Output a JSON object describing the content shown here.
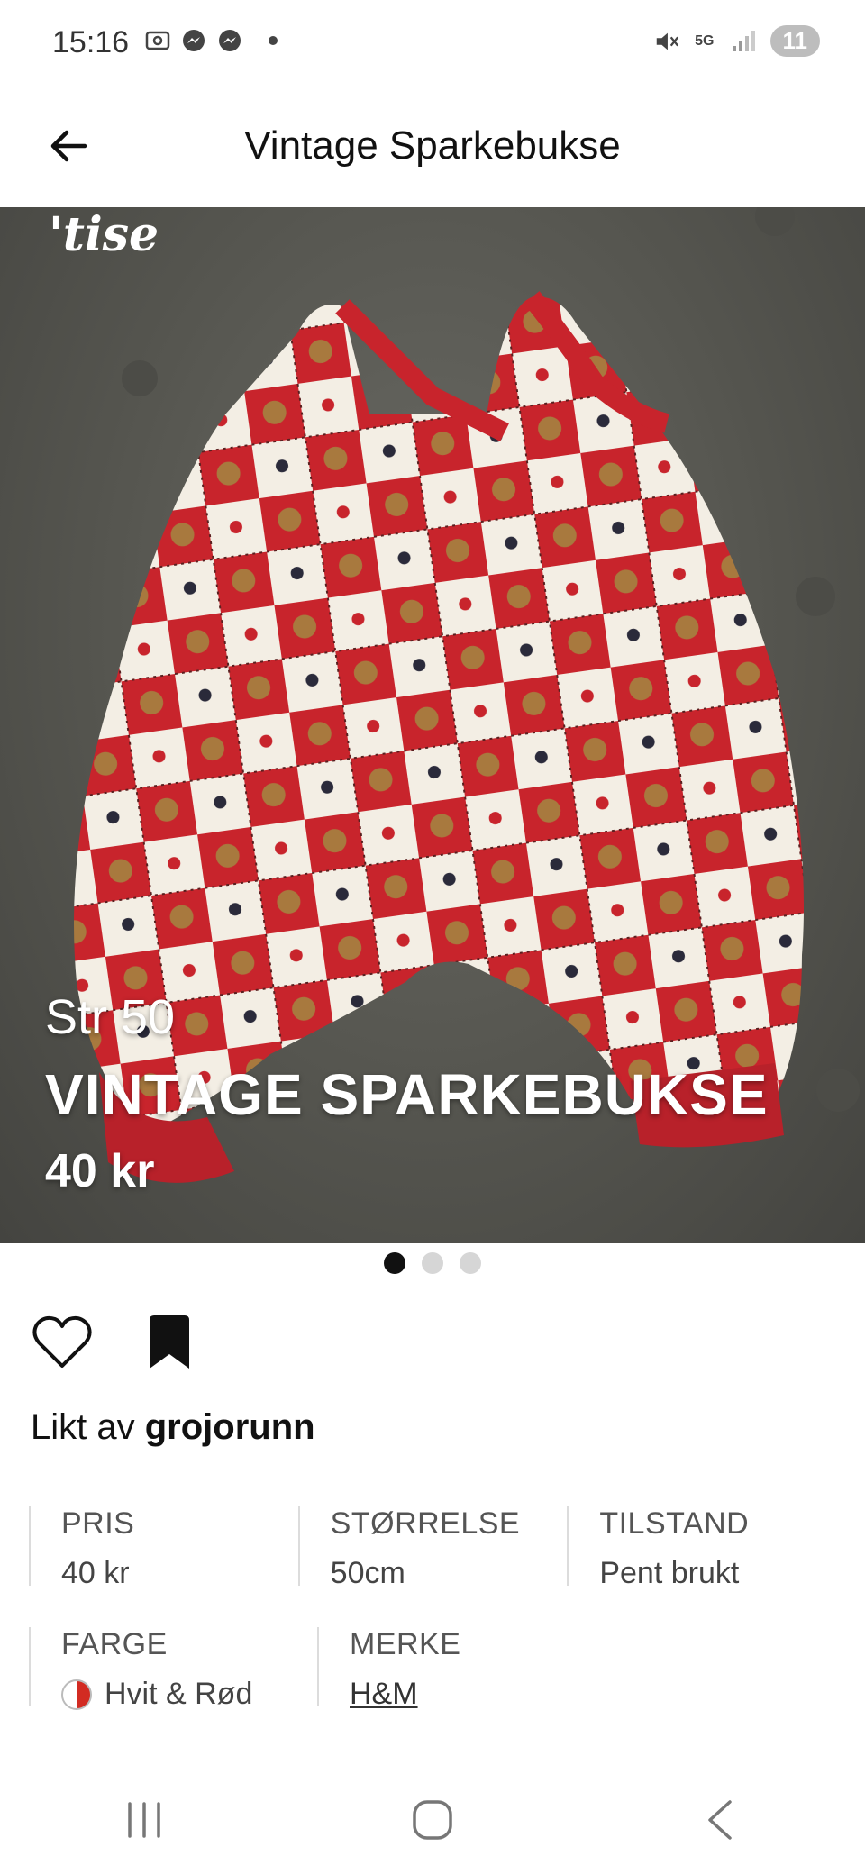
{
  "status_bar": {
    "time": "15:16",
    "network": "5G",
    "battery": "11",
    "icons": [
      "screenshot-icon",
      "messenger-icon",
      "messenger-icon",
      "mute-icon",
      "signal-icon"
    ]
  },
  "app_bar": {
    "title": "Vintage Sparkebukse",
    "back_icon": "arrow-left-icon"
  },
  "hero": {
    "logo": "'tise",
    "overlay_size": "Str 50",
    "overlay_title": "VINTAGE SPARKEBUKSE",
    "overlay_price": "40 kr"
  },
  "pager": {
    "count": 3,
    "active": 0
  },
  "actions": {
    "like_icon": "heart-icon",
    "save_icon": "bookmark-icon"
  },
  "likes": {
    "prefix": "Likt av",
    "user": "grojorunn"
  },
  "details": {
    "price_label": "PRIS",
    "price_value": "40 kr",
    "size_label": "STØRRELSE",
    "size_value": "50cm",
    "condition_label": "TILSTAND",
    "condition_value": "Pent brukt",
    "color_label": "FARGE",
    "color_value": "Hvit & Rød",
    "color_swatch": [
      "#ffffff",
      "#d22b22"
    ],
    "brand_label": "MERKE",
    "brand_value": "H&M"
  },
  "nav_bar": {
    "icons": [
      "recents-icon",
      "home-icon",
      "back-icon"
    ]
  },
  "colors": {
    "garment_red": "#c8242c",
    "garment_white": "#f3eee4",
    "background_gray": "#5c5c56"
  }
}
